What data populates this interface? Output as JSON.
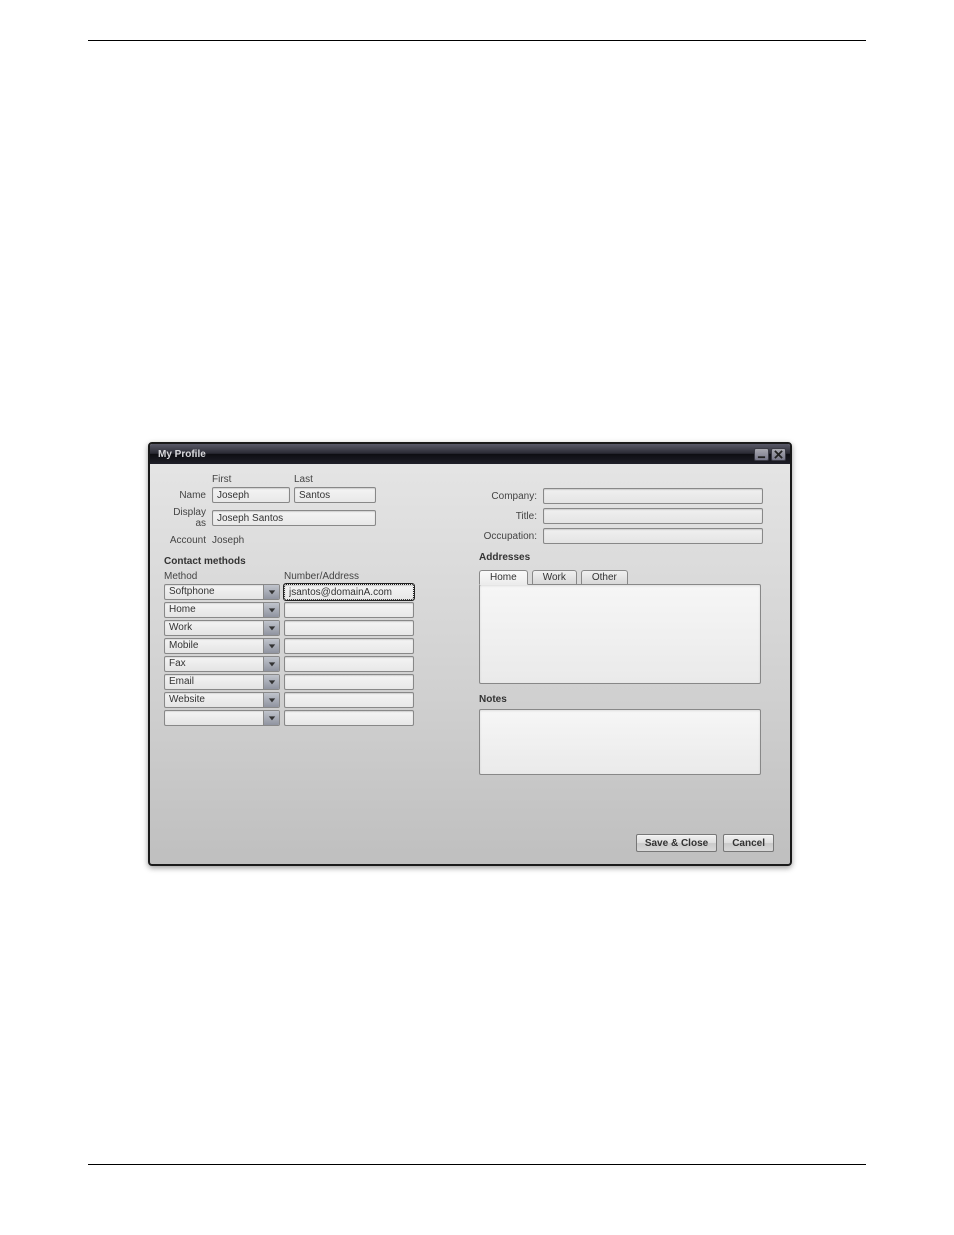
{
  "window": {
    "title": "My Profile"
  },
  "name": {
    "label": "Name",
    "first_header": "First",
    "last_header": "Last",
    "first_value": "Joseph",
    "last_value": "Santos"
  },
  "display_as": {
    "label": "Display as",
    "value": "Joseph Santos"
  },
  "account": {
    "label": "Account",
    "value": "Joseph"
  },
  "contact_methods": {
    "section_title": "Contact methods",
    "method_header": "Method",
    "address_header": "Number/Address",
    "rows": [
      {
        "method": "Softphone",
        "address": "jsantos@domainA.com"
      },
      {
        "method": "Home",
        "address": ""
      },
      {
        "method": "Work",
        "address": ""
      },
      {
        "method": "Mobile",
        "address": ""
      },
      {
        "method": "Fax",
        "address": ""
      },
      {
        "method": "Email",
        "address": ""
      },
      {
        "method": "Website",
        "address": ""
      },
      {
        "method": "",
        "address": ""
      }
    ]
  },
  "right": {
    "company_label": "Company:",
    "company_value": "",
    "title_label": "Title:",
    "title_value": "",
    "occupation_label": "Occupation:",
    "occupation_value": ""
  },
  "addresses": {
    "section_title": "Addresses",
    "tabs": [
      {
        "label": "Home",
        "active": true
      },
      {
        "label": "Work",
        "active": false
      },
      {
        "label": "Other",
        "active": false
      }
    ],
    "content": ""
  },
  "notes": {
    "section_title": "Notes",
    "content": ""
  },
  "buttons": {
    "save_close": "Save & Close",
    "cancel": "Cancel"
  }
}
